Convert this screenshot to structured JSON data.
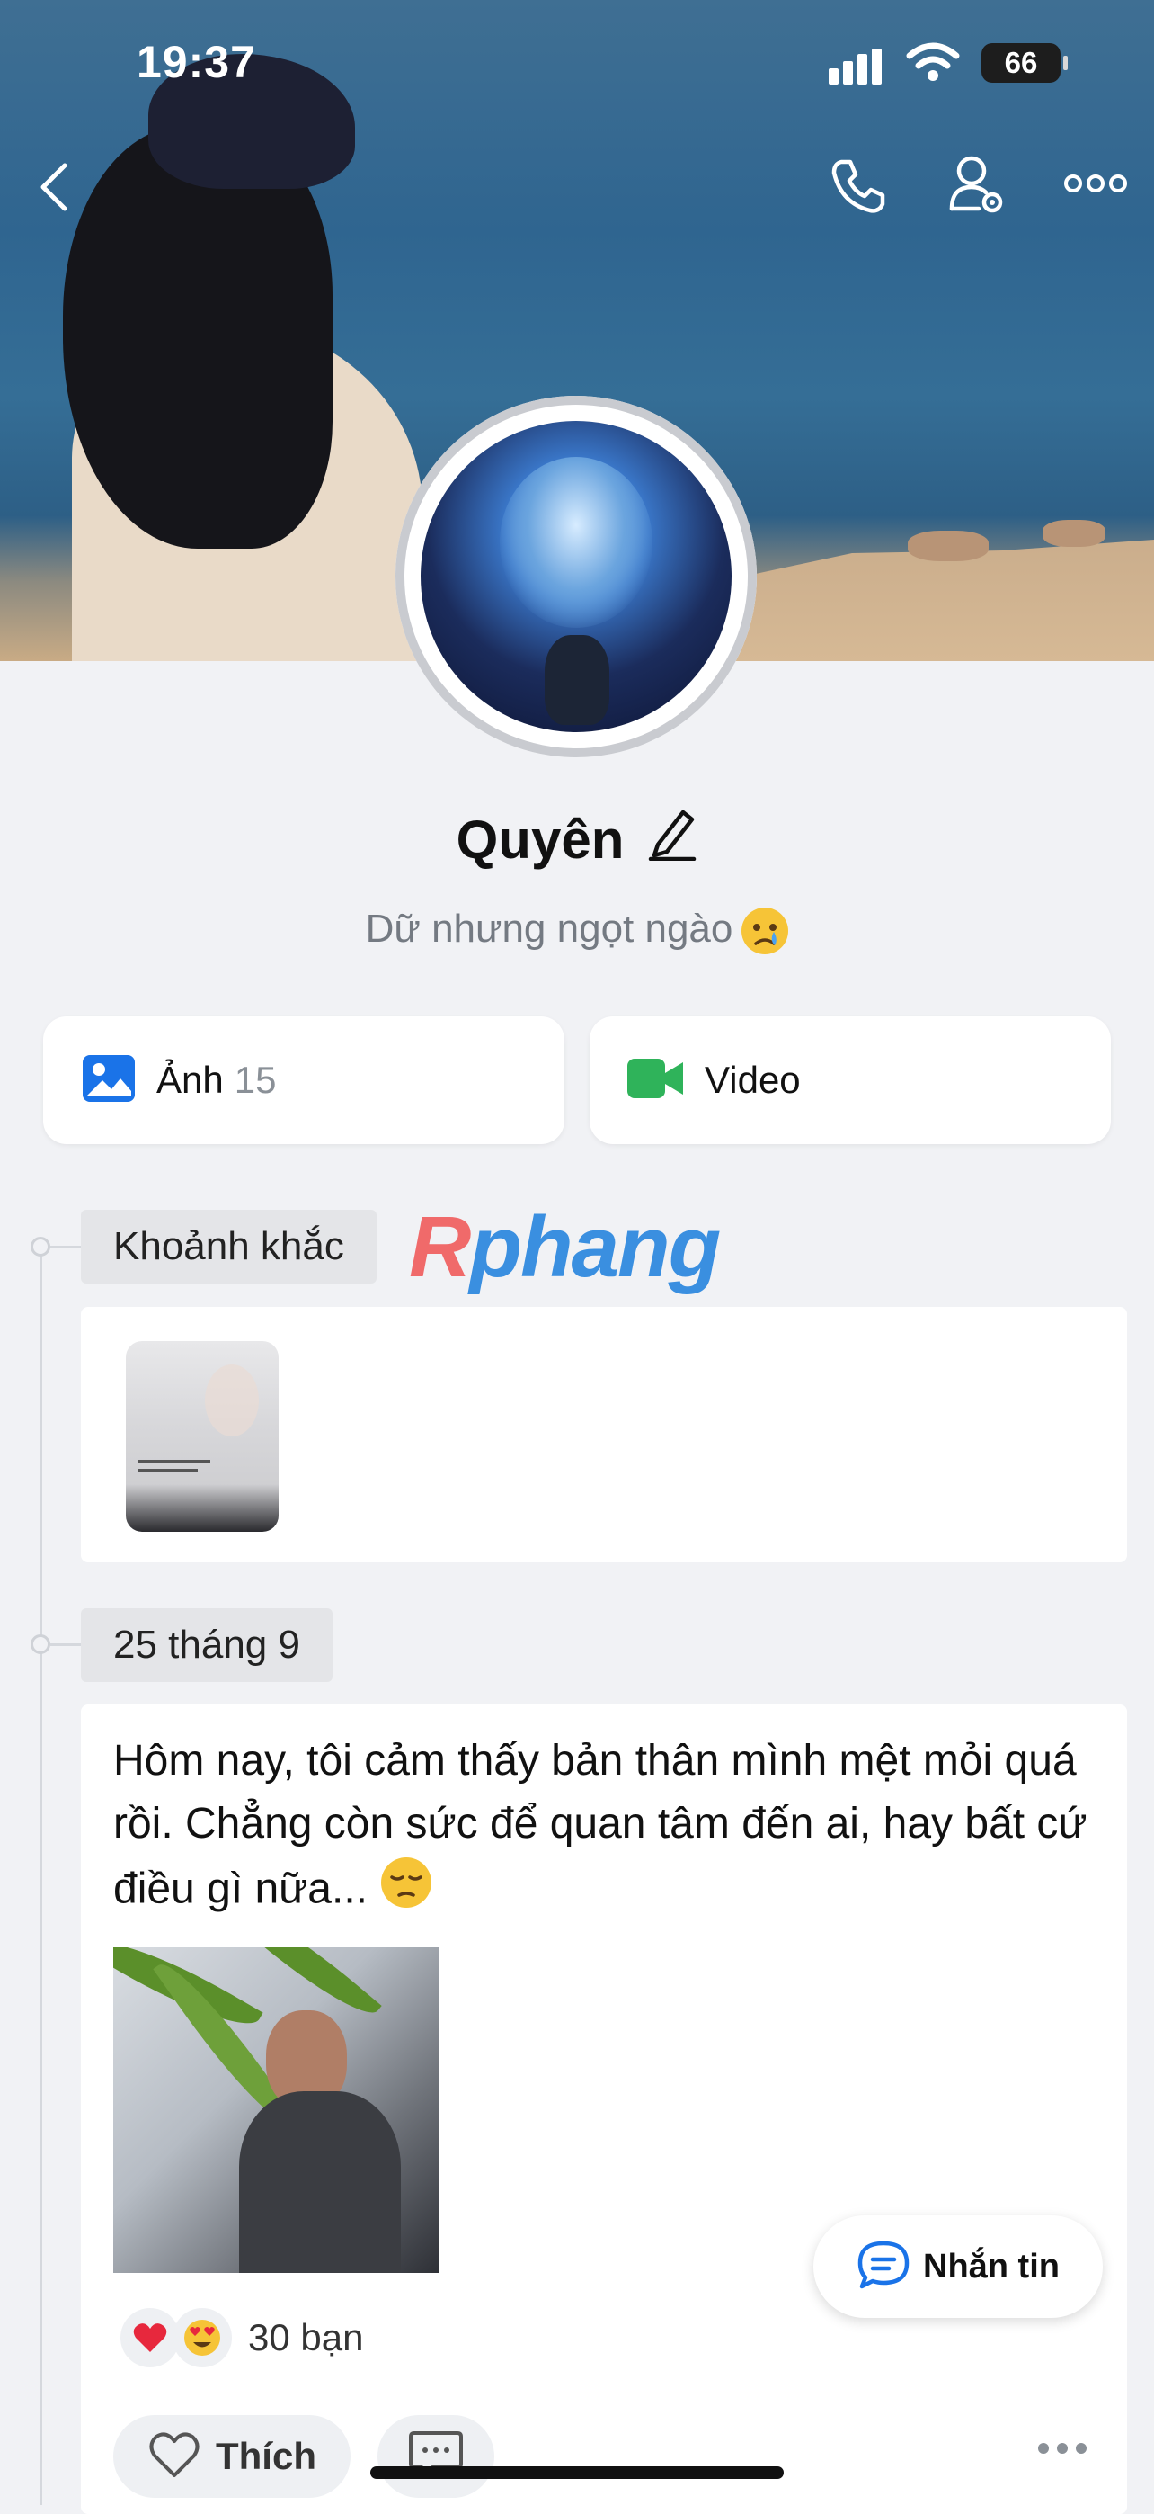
{
  "status_bar": {
    "time": "19:37",
    "battery": "66"
  },
  "profile": {
    "name": "Quyên",
    "bio": "Dữ nhưng ngọt ngào"
  },
  "media": {
    "photos_label": "Ảnh",
    "photos_count": "15",
    "video_label": "Video"
  },
  "watermark": {
    "r": "R",
    "rest": "phang"
  },
  "timeline": {
    "moments_tag": "Khoảnh khắc",
    "date_tag": "25 tháng 9",
    "post_text": "Hôm nay, tôi cảm thấy bản thân mình mệt mỏi quá rồi. Chẳng còn sức để quan tâm đến ai, hay bất cứ điều gì nữa...",
    "reactions_count": "30 bạn",
    "like_label": "Thích"
  },
  "chat_button": {
    "label": "Nhắn tin"
  },
  "icons": [
    "back-icon",
    "phone-icon",
    "user-settings-icon",
    "more-icon",
    "photo-icon",
    "video-icon",
    "edit-icon",
    "heart-icon",
    "comment-icon",
    "chat-icon"
  ]
}
